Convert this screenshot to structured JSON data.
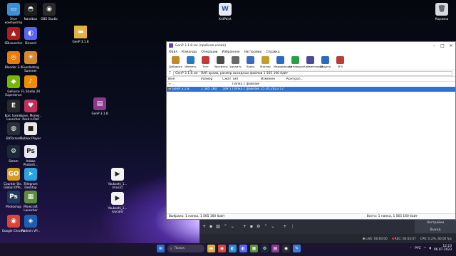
{
  "desktop": {
    "icons": [
      {
        "label": "Этот компьютер",
        "icon": "monitor-icon",
        "color": "#3b8fd6",
        "glyph": "▭"
      },
      {
        "label": "Nandbox",
        "icon": "nandbox-icon",
        "color": "#1d1d1d",
        "glyph": "◓"
      },
      {
        "label": "OBS Studio",
        "icon": "obs-icon",
        "color": "#2a2a2a",
        "glyph": "◉"
      },
      {
        "label": "SBLauncher",
        "icon": "sb-launcher-icon",
        "color": "#b01c1c",
        "glyph": "▲"
      },
      {
        "label": "Discord",
        "icon": "discord-icon",
        "color": "#5865f2",
        "glyph": "◐"
      },
      {
        "label": "Blender 3.4",
        "icon": "blender-icon",
        "color": "#e87d0d",
        "glyph": "◎"
      },
      {
        "label": "Everlasting Summer",
        "icon": "everlasting-summer-icon",
        "color": "#d48a2c",
        "glyph": "☀"
      },
      {
        "label": "GeForce Experience",
        "icon": "geforce-icon",
        "color": "#76b900",
        "glyph": "◆"
      },
      {
        "label": "FL Studio 20",
        "icon": "fl-studio-icon",
        "color": "#f28c00",
        "glyph": "♪"
      },
      {
        "label": "Epic Games Launcher",
        "icon": "epic-games-icon",
        "color": "#2a2a2a",
        "glyph": "E"
      },
      {
        "label": "Love, Money, Rock-n-Roll",
        "icon": "love-money-icon",
        "color": "#c0305a",
        "glyph": "♥"
      },
      {
        "label": "BitTorrent",
        "icon": "bittorrent-icon",
        "color": "#2a2f3a",
        "glyph": "◍"
      },
      {
        "label": "Roblox Player",
        "icon": "roblox-icon",
        "color": "#eaeaea",
        "glyph": "■"
      },
      {
        "label": "Steam",
        "icon": "steam-icon",
        "color": "#1b2838",
        "glyph": "⚙"
      },
      {
        "label": "Adobe Photosh...",
        "icon": "adobe-photoshop-installer-icon",
        "color": "#e8e8f0",
        "glyph": "Ps"
      },
      {
        "label": "Counter Str... Global Offe...",
        "icon": "csgo-icon",
        "color": "#d69a1e",
        "glyph": "GO"
      },
      {
        "label": "Telegram Desktop",
        "icon": "telegram-icon",
        "color": "#2aa3e0",
        "glyph": "➤"
      },
      {
        "label": "Photoshop",
        "icon": "photoshop-icon",
        "color": "#1f3a5a",
        "glyph": "Ps"
      },
      {
        "label": "Minecraft Launcher",
        "icon": "minecraft-icon",
        "color": "#5b8e3a",
        "glyph": "▦"
      },
      {
        "label": "Google Chrome",
        "icon": "chrome-icon",
        "color": "#db4437",
        "glyph": "◉"
      },
      {
        "label": "Radmin VP...",
        "icon": "radmin-icon",
        "color": "#1c5fb0",
        "glyph": "◈"
      }
    ],
    "folder_label": "GenP 3.1.8",
    "rar_file_label": "GenP 3.1.8",
    "krita_label": "KritPaint",
    "video1_label": "Yaukoshi_1... (music)",
    "video2_label": "Yaukoshi_1... (vocals)",
    "recycle_label": "Корзина"
  },
  "rar": {
    "title": "GenP 3.1.8.rar (пробная копия)",
    "menu": [
      "Файл",
      "Команды",
      "Операции",
      "Избранное",
      "Настройки",
      "Справка"
    ],
    "toolbar": [
      {
        "label": "Добавить",
        "icon": "add-icon",
        "color": "#c08a2a"
      },
      {
        "label": "Извлечь в",
        "icon": "extract-icon",
        "color": "#2a7ac0"
      },
      {
        "label": "Тест",
        "icon": "test-icon",
        "color": "#c03a3a"
      },
      {
        "label": "Просмотр",
        "icon": "view-icon",
        "color": "#4a4a4a"
      },
      {
        "label": "Удалить",
        "icon": "delete-icon",
        "color": "#6a6a6a"
      },
      {
        "label": "Поиск",
        "icon": "find-icon",
        "color": "#3a6ac0"
      },
      {
        "label": "Мастер",
        "icon": "wizard-icon",
        "color": "#c0a02a"
      },
      {
        "label": "Информация",
        "icon": "info-icon",
        "color": "#2a6ac0"
      },
      {
        "label": "Антивирус",
        "icon": "antivirus-icon",
        "color": "#2aa04a"
      },
      {
        "label": "Комментарий",
        "icon": "comment-icon",
        "color": "#4a4a9a"
      },
      {
        "label": "Защита",
        "icon": "protect-icon",
        "color": "#2a6ac0"
      },
      {
        "label": "SFX",
        "icon": "sfx-icon",
        "color": "#c03a3a"
      }
    ],
    "path": "GenP 3.1.8.rar - RAR архив, размер исходных файлов 1 565 160 байт",
    "columns": [
      "Имя",
      "Размер",
      "Сжат",
      "Тип",
      "Изменён",
      "Контрол..."
    ],
    "rows": [
      {
        "name": "..",
        "size": "",
        "packed": "",
        "type": "Папка с файлами",
        "modified": "",
        "crc": ""
      },
      {
        "name": "GenP 3.1.8",
        "size": "1 565 160",
        "packed": "509 578",
        "type": "Папка с файлами",
        "modified": "25.05.2023 17:51",
        "crc": ""
      }
    ],
    "status_left": "Выбрано: 1 папка, 1 565 160 байт",
    "status_right": "Всего: 1 папка, 1 565 160 байт"
  },
  "obs": {
    "settings_label": "Настройки",
    "exit_label": "Выход",
    "live": "LIVE: 00:00:00",
    "rec": "REC: 00:03:07",
    "cpu": "CPU: 0.2%, 60.00 fps"
  },
  "taskbar": {
    "search_placeholder": "Поиск",
    "apps": [
      {
        "icon": "explorer-icon",
        "color": "#e0b030",
        "glyph": "▬"
      },
      {
        "icon": "chrome-taskbar-icon",
        "color": "#db4437",
        "glyph": "◉"
      },
      {
        "icon": "edge-icon",
        "color": "#2a8ad6",
        "glyph": "◐"
      },
      {
        "icon": "discord-taskbar-icon",
        "color": "#5865f2",
        "glyph": "◐"
      },
      {
        "icon": "minecraft-taskbar-icon",
        "color": "#5b8e3a",
        "glyph": "▦"
      },
      {
        "icon": "steam-taskbar-icon",
        "color": "#1b2838",
        "glyph": "⚙"
      },
      {
        "icon": "winrar-taskbar-icon",
        "color": "#8a3a8a",
        "glyph": "▤"
      },
      {
        "icon": "obs-taskbar-icon",
        "color": "#2a2a2a",
        "glyph": "◉"
      },
      {
        "icon": "krita-taskbar-icon",
        "color": "#3a7ad6",
        "glyph": "✎"
      }
    ],
    "lang": "РУС",
    "time": "12:23",
    "date": "06.07.2023"
  }
}
